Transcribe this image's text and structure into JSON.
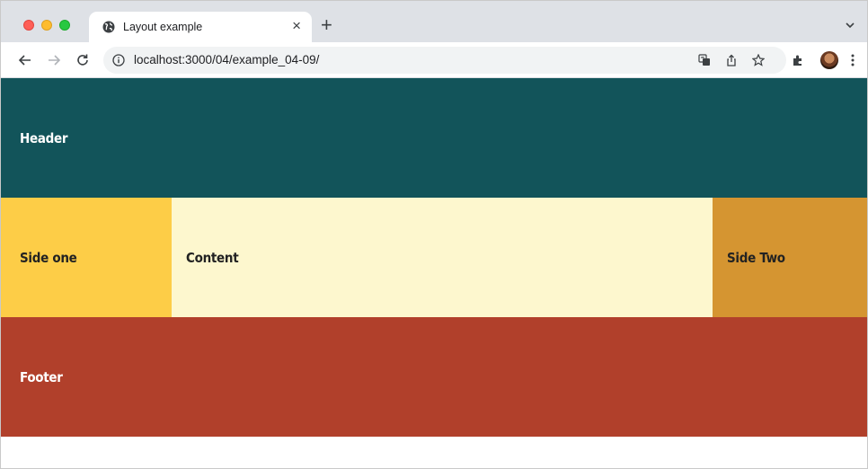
{
  "window": {
    "traffic_lights": [
      "close",
      "minimize",
      "zoom"
    ]
  },
  "tab": {
    "title": "Layout example",
    "favicon": "globe-icon",
    "close_glyph": "×"
  },
  "toolbar": {
    "new_tab_glyph": "+",
    "url": "localhost:3000/04/example_04-09/",
    "icons": [
      "back-icon",
      "forward-icon",
      "reload-icon",
      "info-icon",
      "translate-icon",
      "share-icon",
      "star-icon",
      "extensions-icon",
      "avatar",
      "menu-icon"
    ]
  },
  "page": {
    "header": "Header",
    "side_one": "Side one",
    "content": "Content",
    "side_two": "Side Two",
    "footer": "Footer"
  },
  "colors": {
    "header": "#12545a",
    "side_one": "#fdcd47",
    "content": "#fdf7ce",
    "side_two": "#d59531",
    "footer": "#b1402b"
  }
}
